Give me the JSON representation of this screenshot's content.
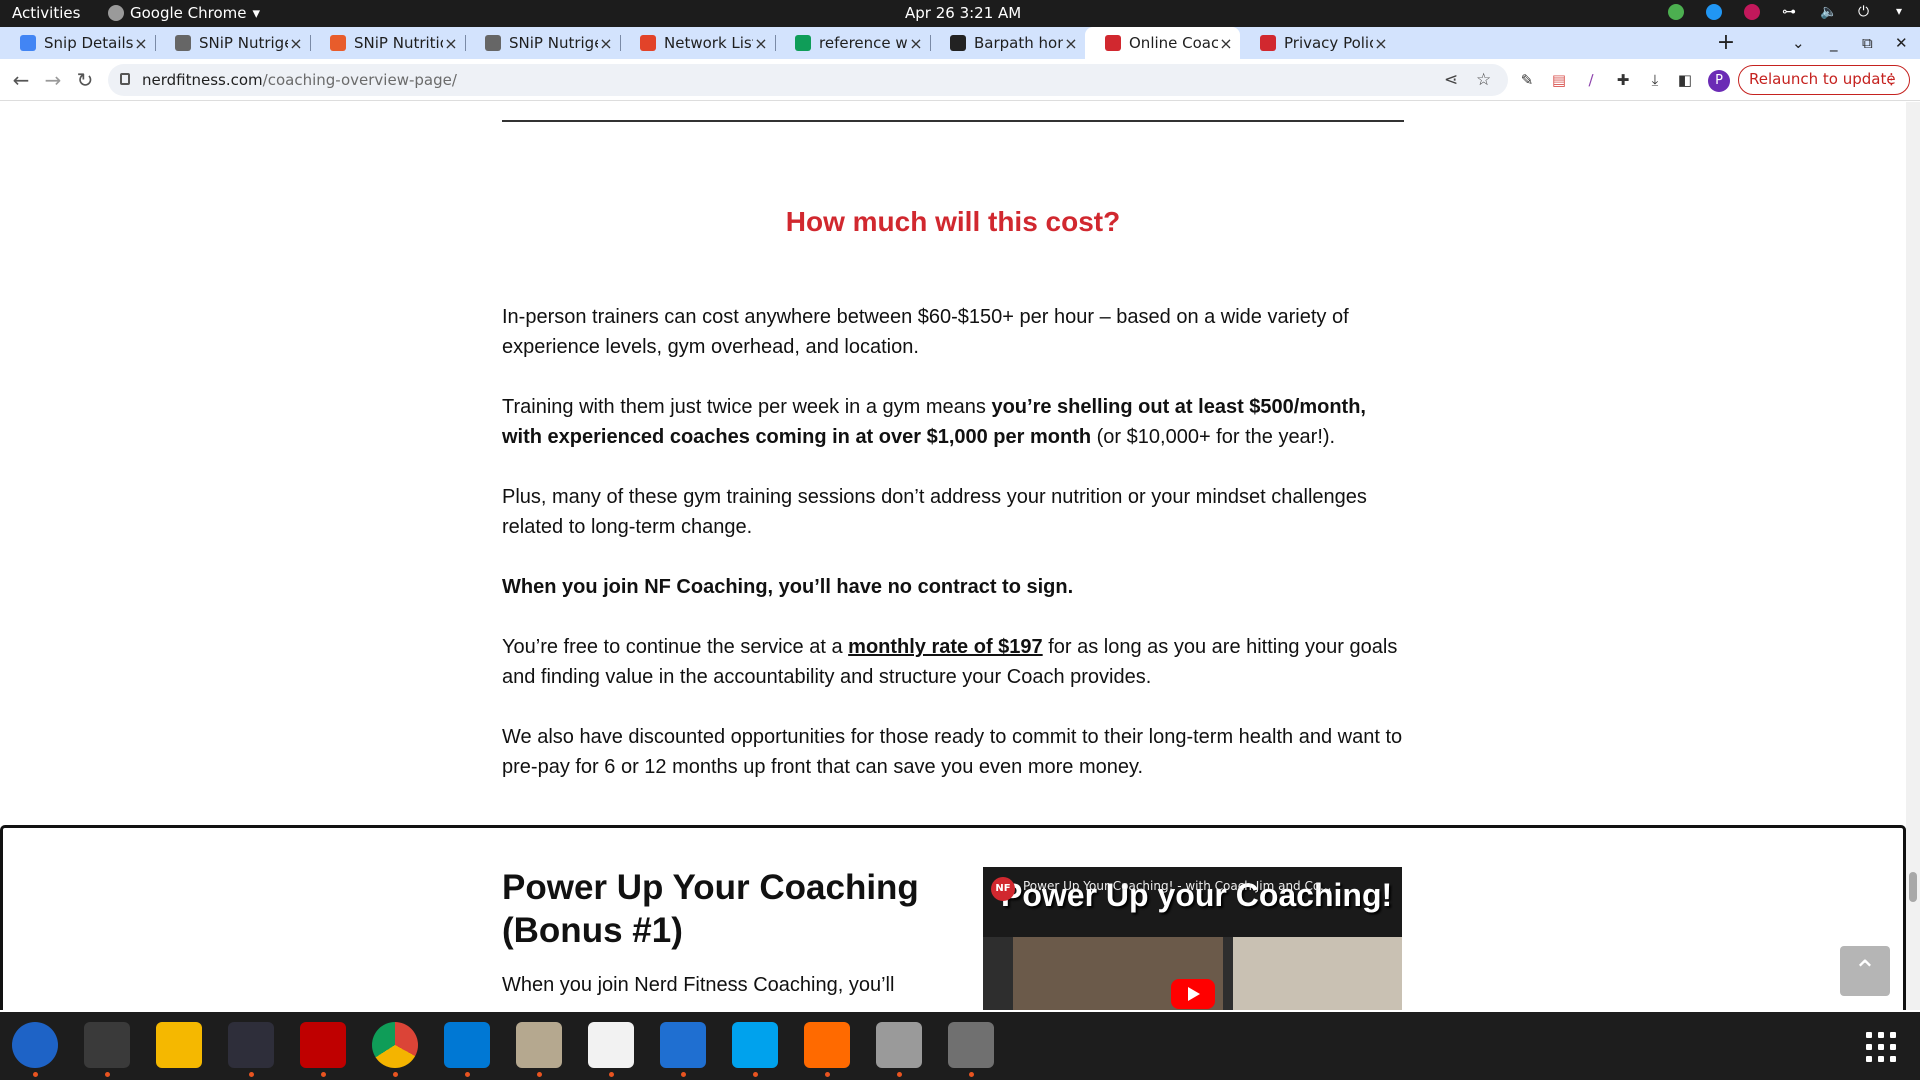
{
  "topbar": {
    "activities": "Activities",
    "app_name": "Google Chrome",
    "clock": "Apr 26  3:21 AM"
  },
  "tabs": [
    {
      "title": "Snip Details - Goo",
      "favicon_color": "#4285f4"
    },
    {
      "title": "SNiP Nutrigenomi",
      "favicon_color": "#666666"
    },
    {
      "title": "SNiP Nutrition",
      "favicon_color": "#e85c2b"
    },
    {
      "title": "SNiP Nutrigenomi",
      "favicon_color": "#666666"
    },
    {
      "title": "Network List to Ac",
      "favicon_color": "#e24329"
    },
    {
      "title": "reference website",
      "favicon_color": "#0f9d58"
    },
    {
      "title": "Barpath home - Ba",
      "favicon_color": "#222222"
    },
    {
      "title": "Online Coaching: I",
      "favicon_color": "#d1282f",
      "active": true
    },
    {
      "title": "Privacy Policy",
      "favicon_color": "#d1282f"
    }
  ],
  "address_bar": {
    "domain": "nerdfitness.com",
    "path": "/coaching-overview-page/",
    "relaunch_label": "Relaunch to update",
    "profile_initial": "P"
  },
  "article": {
    "heading": "How much will this cost?",
    "p1": "In-person trainers can cost anywhere between $60-$150+ per hour – based on a wide variety of experience levels, gym overhead, and location.",
    "p2_start": "Training with them just twice per week in a gym means ",
    "p2_bold": "you’re shelling out at least $500/month, with experienced coaches coming in at over $1,000 per month",
    "p2_end": " (or $10,000+ for the year!).",
    "p3": "Plus, many of these gym training sessions don’t address your nutrition or your mindset challenges related to long-term change.",
    "p4": "When you join NF Coaching, you’ll have no contract to sign.",
    "p5_start": "You’re free to continue the service at a ",
    "p5_link": "monthly rate of $197",
    "p5_end": " for as long as you are hitting your goals and finding value in the accountability and structure your Coach provides.",
    "p6": "We also have discounted opportunities for those ready to commit to their long-term health and want to pre-pay for 6 or 12 months up front that can save you even more money."
  },
  "bonus": {
    "title": "Power Up Your Coaching (Bonus #1)",
    "text": "When you join Nerd Fitness Coaching, you’ll",
    "video_caption": "Power Up Your Coaching! - with Coach Jim and Co...",
    "video_title": "Power Up your Coaching!",
    "video_logo": "NF"
  },
  "colors": {
    "accent": "#d1282f",
    "tabstrip": "#d3e3fd",
    "relaunch": "#c5221f"
  },
  "dock_apps": [
    "thunderbird-icon",
    "terminal-icon",
    "calculator-icon",
    "system-monitor-icon",
    "filezilla-icon",
    "chrome-icon",
    "vscode-icon",
    "files-icon",
    "text-editor-icon",
    "document-viewer-icon",
    "skype-icon",
    "firefox-dev-icon",
    "image-viewer-icon",
    "disk-icon"
  ]
}
